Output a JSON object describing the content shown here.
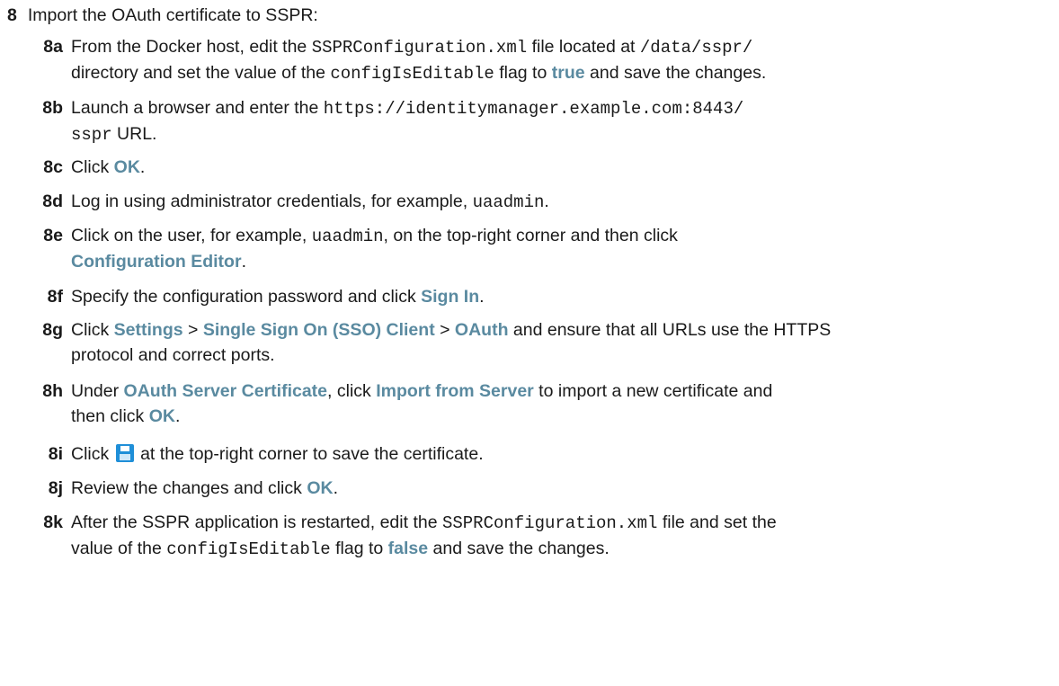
{
  "step": {
    "number": "8",
    "text": "Import the OAuth certificate to SSPR:"
  },
  "substeps": {
    "s8a": {
      "num": "8a",
      "t1": "From the Docker host, edit the ",
      "c1": "SSPRConfiguration.xml",
      "t2": " file located at ",
      "c2": "/data/sspr/",
      "t3": "directory and set the value of the ",
      "c3": "configIsEditable",
      "t4": " flag to ",
      "u1": "true",
      "t5": " and save the changes."
    },
    "s8b": {
      "num": "8b",
      "t1": "Launch a browser and enter the ",
      "c1": "https://identitymanager.example.com:8443/",
      "c2": "sspr",
      "t2": " URL."
    },
    "s8c": {
      "num": "8c",
      "t1": "Click ",
      "u1": "OK",
      "t2": "."
    },
    "s8d": {
      "num": "8d",
      "t1": "Log in using administrator credentials, for example, ",
      "c1": "uaadmin",
      "t2": "."
    },
    "s8e": {
      "num": "8e",
      "t1": "Click on the user, for example, ",
      "c1": "uaadmin",
      "t2": ", on the top-right corner and then click",
      "u1": "Configuration Editor",
      "t3": "."
    },
    "s8f": {
      "num": "8f",
      "t1": "Specify the configuration password and click ",
      "u1": "Sign In",
      "t2": "."
    },
    "s8g": {
      "num": "8g",
      "t1": "Click ",
      "u1": "Settings",
      "t2": " > ",
      "u2": "Single Sign On (SSO) Client",
      "t3": " > ",
      "u3": "OAuth",
      "t4": " and ensure that all URLs use the HTTPS",
      "t5": "protocol and correct ports."
    },
    "s8h": {
      "num": "8h",
      "t1": "Under ",
      "u1": "OAuth Server Certificate",
      "t2": ", click ",
      "u2": "Import from Server",
      "t3": " to import a new certificate and",
      "t4": "then click ",
      "u3": "OK",
      "t5": "."
    },
    "s8i": {
      "num": "8i",
      "t1": "Click ",
      "icon": "save-icon",
      "t2": " at the top-right corner to save the certificate."
    },
    "s8j": {
      "num": "8j",
      "t1": "Review the changes and click ",
      "u1": "OK",
      "t2": "."
    },
    "s8k": {
      "num": "8k",
      "t1": "After the SSPR application is restarted, edit the ",
      "c1": "SSPRConfiguration.xml",
      "t2": " file and set the",
      "t3": "value of the ",
      "c2": "configIsEditable",
      "t4": " flag to ",
      "u1": "false",
      "t5": " and save the changes."
    }
  },
  "colors": {
    "ui_reference": "#5a8aa0",
    "text": "#1a1a1a",
    "save_icon": "#1f8fd8"
  }
}
